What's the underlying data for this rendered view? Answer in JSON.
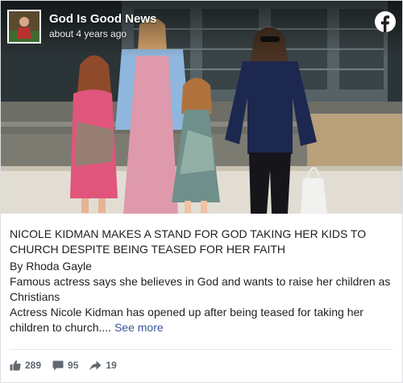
{
  "post": {
    "page_name": "God Is Good News",
    "timestamp": "about 4 years ago",
    "headline": "NICOLE KIDMAN MAKES A STAND FOR GOD TAKING HER KIDS TO CHURCH DESPITE BEING TEASED FOR HER FAITH",
    "byline": "By Rhoda Gayle",
    "subhead": "Famous actress says she believes in God and wants to raise her children as Christians",
    "excerpt": "Actress Nicole Kidman has opened up after being teased for taking her children to church....",
    "see_more_label": "See more"
  },
  "stats": {
    "likes": "289",
    "comments": "95",
    "shares": "19"
  },
  "icons": {
    "logo": "facebook-icon",
    "like": "thumbs-up-icon",
    "comment": "comment-icon",
    "share": "share-arrow-icon"
  },
  "colors": {
    "link": "#385898",
    "text": "#1c1e21",
    "meta": "#606770",
    "facebook": "#ffffff"
  }
}
